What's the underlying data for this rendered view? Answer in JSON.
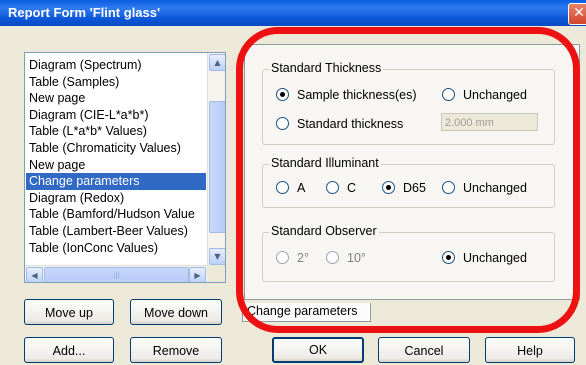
{
  "window": {
    "title": "Report Form 'Flint glass'",
    "close_glyph": "✕"
  },
  "list": {
    "items": [
      "Diagram (Spectrum)",
      "Table (Samples)",
      "New page",
      "Diagram (CIE-L*a*b*)",
      "Table (L*a*b* Values)",
      "Table (Chromaticity Values)",
      "New page",
      "Change parameters",
      "Diagram (Redox)",
      "Table (Bamford/Hudson Value",
      "Table (Lambert-Beer Values)",
      "Table (IonConc Values)"
    ],
    "selected_index": 7
  },
  "buttons": {
    "move_up": "Move up",
    "move_down": "Move down",
    "add": "Add...",
    "remove": "Remove",
    "ok": "OK",
    "cancel": "Cancel",
    "help": "Help"
  },
  "tab": {
    "label": "Change parameters"
  },
  "thickness": {
    "title": "Standard Thickness",
    "opt_sample": "Sample thickness(es)",
    "opt_unchanged": "Unchanged",
    "opt_standard": "Standard thickness",
    "value": "2.000 mm",
    "selected": "Sample thickness(es)"
  },
  "illuminant": {
    "title": "Standard Illuminant",
    "opt_a": "A",
    "opt_c": "C",
    "opt_d65": "D65",
    "opt_unchanged": "Unchanged",
    "selected": "D65"
  },
  "observer": {
    "title": "Standard Observer",
    "opt_2": "2°",
    "opt_10": "10°",
    "opt_unchanged": "Unchanged",
    "selected": "Unchanged"
  },
  "colors": {
    "titlebar": "#0a5ee0",
    "selection": "#316ac5",
    "highlight": "#ee1111"
  }
}
